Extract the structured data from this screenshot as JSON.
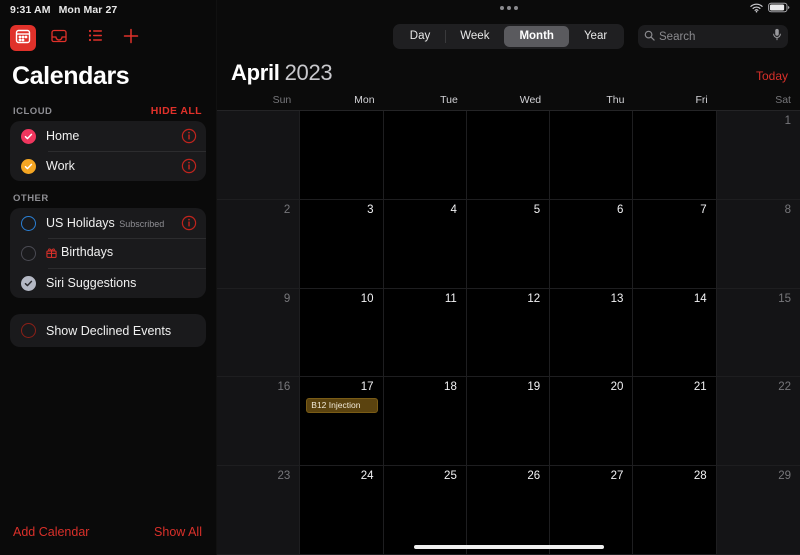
{
  "status_bar": {
    "time": "9:31 AM",
    "date": "Mon Mar 27",
    "wifi_icon": "wifi-icon",
    "battery_icon": "battery-icon"
  },
  "sidebar": {
    "toolbar": [
      {
        "name": "calendar-view-button",
        "icon": "calendar-icon",
        "active": true
      },
      {
        "name": "inbox-button",
        "icon": "inbox-tray-icon",
        "active": false
      },
      {
        "name": "list-view-button",
        "icon": "list-icon",
        "active": false
      },
      {
        "name": "add-event-button",
        "icon": "plus-icon",
        "active": false
      }
    ],
    "title": "Calendars",
    "sections": [
      {
        "label": "ICLOUD",
        "action_label": "HIDE ALL",
        "items": [
          {
            "label": "Home",
            "subtitle": "",
            "checked": true,
            "color": "#f0365e",
            "has_info": true,
            "has_gift": false
          },
          {
            "label": "Work",
            "subtitle": "",
            "checked": true,
            "color": "#f5a623",
            "has_info": true,
            "has_gift": false
          }
        ]
      },
      {
        "label": "OTHER",
        "action_label": "",
        "items": [
          {
            "label": "US Holidays",
            "subtitle": "Subscribed",
            "checked": false,
            "color": "#2a7fd4",
            "has_info": true,
            "has_gift": false
          },
          {
            "label": "Birthdays",
            "subtitle": "",
            "checked": false,
            "color": "#4a4a52",
            "has_info": false,
            "has_gift": true
          },
          {
            "label": "Siri Suggestions",
            "subtitle": "",
            "checked": true,
            "color": "#b4b8c4",
            "has_info": false,
            "has_gift": false
          }
        ]
      }
    ],
    "declined": {
      "label": "Show Declined Events",
      "checked": false,
      "color": "#8c2018"
    },
    "footer": {
      "add_label": "Add Calendar",
      "show_all_label": "Show All"
    }
  },
  "main": {
    "view_segments": [
      {
        "label": "Day",
        "selected": false
      },
      {
        "label": "Week",
        "selected": false
      },
      {
        "label": "Month",
        "selected": true
      },
      {
        "label": "Year",
        "selected": false
      }
    ],
    "search": {
      "placeholder": "Search",
      "value": "",
      "icon": "search-icon",
      "mic_icon": "microphone-icon"
    },
    "month_name": "April",
    "year": "2023",
    "today_label": "Today",
    "weekdays": [
      {
        "label": "Sun",
        "weekend": true
      },
      {
        "label": "Mon",
        "weekend": false
      },
      {
        "label": "Tue",
        "weekend": false
      },
      {
        "label": "Wed",
        "weekend": false
      },
      {
        "label": "Thu",
        "weekend": false
      },
      {
        "label": "Fri",
        "weekend": false
      },
      {
        "label": "Sat",
        "weekend": true
      }
    ],
    "days": [
      {
        "num": "",
        "weekend": true,
        "empty": true,
        "events": []
      },
      {
        "num": "",
        "weekend": false,
        "empty": true,
        "events": []
      },
      {
        "num": "",
        "weekend": false,
        "empty": true,
        "events": []
      },
      {
        "num": "",
        "weekend": false,
        "empty": true,
        "events": []
      },
      {
        "num": "",
        "weekend": false,
        "empty": true,
        "events": []
      },
      {
        "num": "",
        "weekend": false,
        "empty": true,
        "events": []
      },
      {
        "num": "1",
        "weekend": true,
        "empty": false,
        "events": []
      },
      {
        "num": "2",
        "weekend": true,
        "empty": false,
        "events": []
      },
      {
        "num": "3",
        "weekend": false,
        "empty": false,
        "events": []
      },
      {
        "num": "4",
        "weekend": false,
        "empty": false,
        "events": []
      },
      {
        "num": "5",
        "weekend": false,
        "empty": false,
        "events": []
      },
      {
        "num": "6",
        "weekend": false,
        "empty": false,
        "events": []
      },
      {
        "num": "7",
        "weekend": false,
        "empty": false,
        "events": []
      },
      {
        "num": "8",
        "weekend": true,
        "empty": false,
        "events": []
      },
      {
        "num": "9",
        "weekend": true,
        "empty": false,
        "events": []
      },
      {
        "num": "10",
        "weekend": false,
        "empty": false,
        "events": []
      },
      {
        "num": "11",
        "weekend": false,
        "empty": false,
        "events": []
      },
      {
        "num": "12",
        "weekend": false,
        "empty": false,
        "events": []
      },
      {
        "num": "13",
        "weekend": false,
        "empty": false,
        "events": []
      },
      {
        "num": "14",
        "weekend": false,
        "empty": false,
        "events": []
      },
      {
        "num": "15",
        "weekend": true,
        "empty": false,
        "events": []
      },
      {
        "num": "16",
        "weekend": true,
        "empty": false,
        "events": []
      },
      {
        "num": "17",
        "weekend": false,
        "empty": false,
        "events": [
          {
            "title": "B12 Injection",
            "color": "#5b430f"
          }
        ]
      },
      {
        "num": "18",
        "weekend": false,
        "empty": false,
        "events": []
      },
      {
        "num": "19",
        "weekend": false,
        "empty": false,
        "events": []
      },
      {
        "num": "20",
        "weekend": false,
        "empty": false,
        "events": []
      },
      {
        "num": "21",
        "weekend": false,
        "empty": false,
        "events": []
      },
      {
        "num": "22",
        "weekend": true,
        "empty": false,
        "events": []
      },
      {
        "num": "23",
        "weekend": true,
        "empty": false,
        "events": []
      },
      {
        "num": "24",
        "weekend": false,
        "empty": false,
        "events": []
      },
      {
        "num": "25",
        "weekend": false,
        "empty": false,
        "events": []
      },
      {
        "num": "26",
        "weekend": false,
        "empty": false,
        "events": []
      },
      {
        "num": "27",
        "weekend": false,
        "empty": false,
        "events": []
      },
      {
        "num": "28",
        "weekend": false,
        "empty": false,
        "events": []
      },
      {
        "num": "29",
        "weekend": true,
        "empty": false,
        "events": []
      }
    ]
  }
}
